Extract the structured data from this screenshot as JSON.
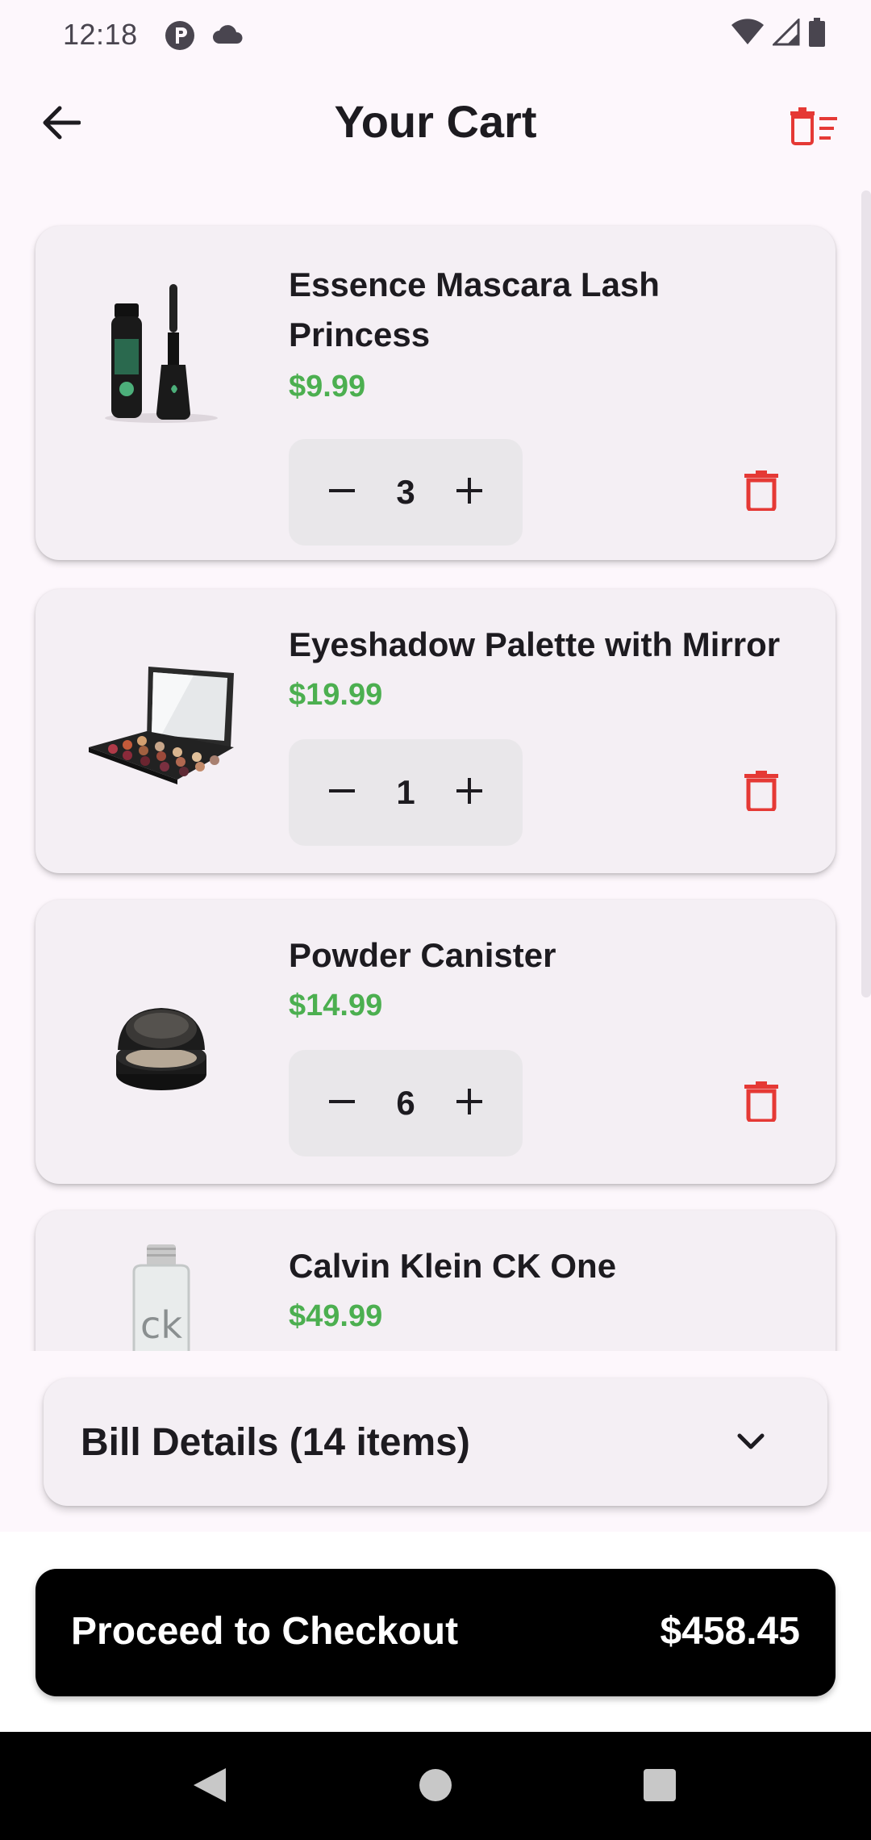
{
  "status_bar": {
    "time": "12:18",
    "icons": [
      "notification-p-icon",
      "cloud-icon",
      "wifi-icon",
      "signal-icon",
      "battery-icon"
    ]
  },
  "app_bar": {
    "title": "Your Cart",
    "back_icon": "arrow-left-icon",
    "clear_icon": "delete-sweep-icon"
  },
  "cart": {
    "items": [
      {
        "name": "Essence Mascara Lash Princess",
        "price": "$9.99",
        "quantity": "3",
        "image": "mascara"
      },
      {
        "name": "Eyeshadow Palette with Mirror",
        "price": "$19.99",
        "quantity": "1",
        "image": "eyeshadow-palette"
      },
      {
        "name": "Powder Canister",
        "price": "$14.99",
        "quantity": "6",
        "image": "powder-canister"
      },
      {
        "name": "Calvin Klein CK One",
        "price": "$49.99",
        "quantity": "",
        "image": "perfume-bottle"
      }
    ]
  },
  "bill": {
    "label": "Bill Details (14 items)"
  },
  "checkout": {
    "label": "Proceed to Checkout",
    "total": "$458.45"
  },
  "colors": {
    "price_green": "#4caf50",
    "delete_red": "#e53935",
    "card_bg": "#f4eff4",
    "page_bg": "#fdf7fc"
  }
}
